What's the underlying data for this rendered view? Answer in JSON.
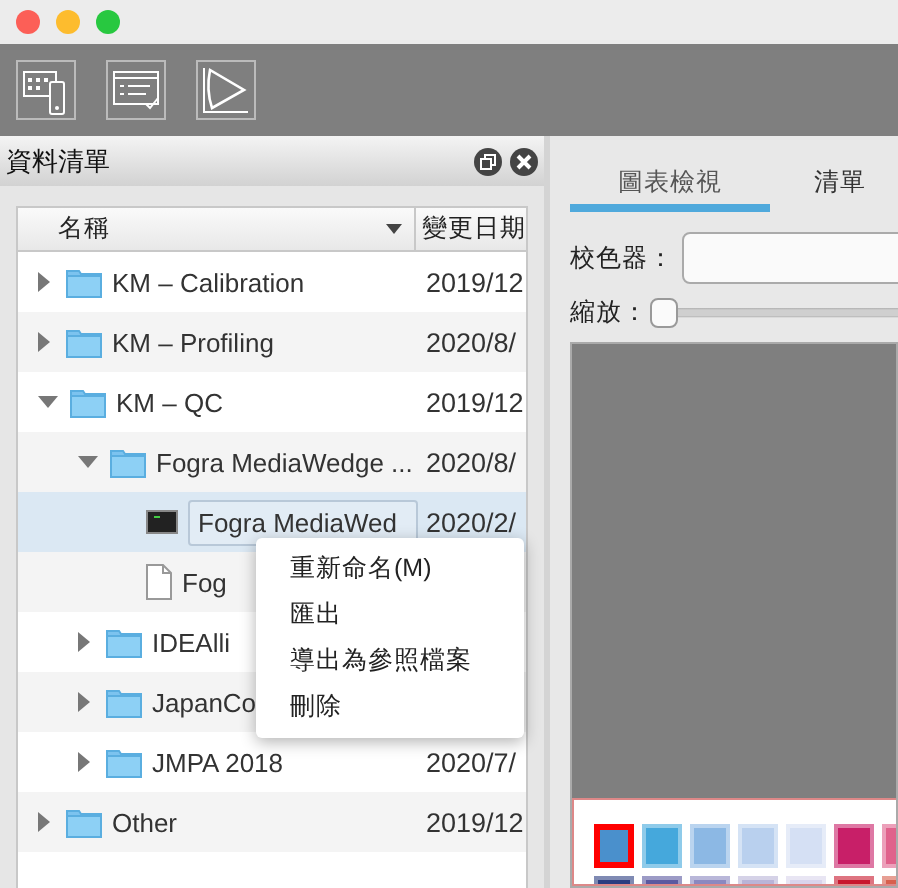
{
  "panel": {
    "title": "資料清單"
  },
  "tree": {
    "columns": [
      {
        "label": "名稱",
        "sorted": true
      },
      {
        "label": "變更日期",
        "sorted": false
      }
    ],
    "items": [
      {
        "name": "KM – Calibration",
        "date": "2019/12",
        "kind": "folder",
        "expanded": false,
        "selected": false
      },
      {
        "name": "KM – Profiling",
        "date": "2020/8/",
        "kind": "folder",
        "expanded": false,
        "selected": false
      },
      {
        "name": "KM – QC",
        "date": "2019/12",
        "kind": "folder",
        "expanded": true,
        "selected": false,
        "children": [
          {
            "name": "Fogra MediaWedge ...",
            "date": "2020/8/",
            "kind": "folder",
            "expanded": true,
            "selected": false,
            "children": [
              {
                "name": "Fogra MediaWed",
                "date": "2020/2/",
                "kind": "measurement",
                "selected": true,
                "editing": true
              },
              {
                "name": "Fog",
                "kind": "document",
                "selected": false
              }
            ]
          },
          {
            "name": "IDEAlli",
            "kind": "folder",
            "expanded": false,
            "selected": false
          },
          {
            "name": "JapanCo",
            "kind": "folder",
            "expanded": false,
            "selected": false
          },
          {
            "name": "JMPA 2018",
            "date": "2020/7/",
            "kind": "folder",
            "expanded": false,
            "selected": false
          }
        ]
      },
      {
        "name": "Other",
        "date": "2019/12",
        "kind": "folder",
        "expanded": false,
        "selected": false
      }
    ]
  },
  "context_menu": [
    "重新命名(M)",
    "匯出",
    "導出為參照檔案",
    "刪除"
  ],
  "tabs": [
    {
      "label": "圖表檢視",
      "selected": true
    },
    {
      "label": "清單",
      "selected": false
    }
  ],
  "calibrator": {
    "label": "校色器："
  },
  "zoom": {
    "label": "縮放：",
    "level": 0
  },
  "swatches": [
    {
      "color": "#4a90cc",
      "selected": true
    },
    {
      "color": "#45a8dc",
      "selected": false
    },
    {
      "color": "#8cb8e4",
      "selected": false
    },
    {
      "color": "#b9d0ee",
      "selected": false
    },
    {
      "color": "#d5e0f4",
      "selected": false
    },
    {
      "color": "#c81f68",
      "selected": false
    },
    {
      "color": "#e0628c",
      "selected": false
    },
    {
      "color": "#2b3d80",
      "selected": false
    },
    {
      "color": "#5b59a0",
      "selected": false
    },
    {
      "color": "#8b88c0",
      "selected": false
    },
    {
      "color": "#b9b4d8",
      "selected": false
    },
    {
      "color": "#d9d4ec",
      "selected": false
    },
    {
      "color": "#c8182e",
      "selected": false
    },
    {
      "color": "#d8604e",
      "selected": false
    }
  ]
}
